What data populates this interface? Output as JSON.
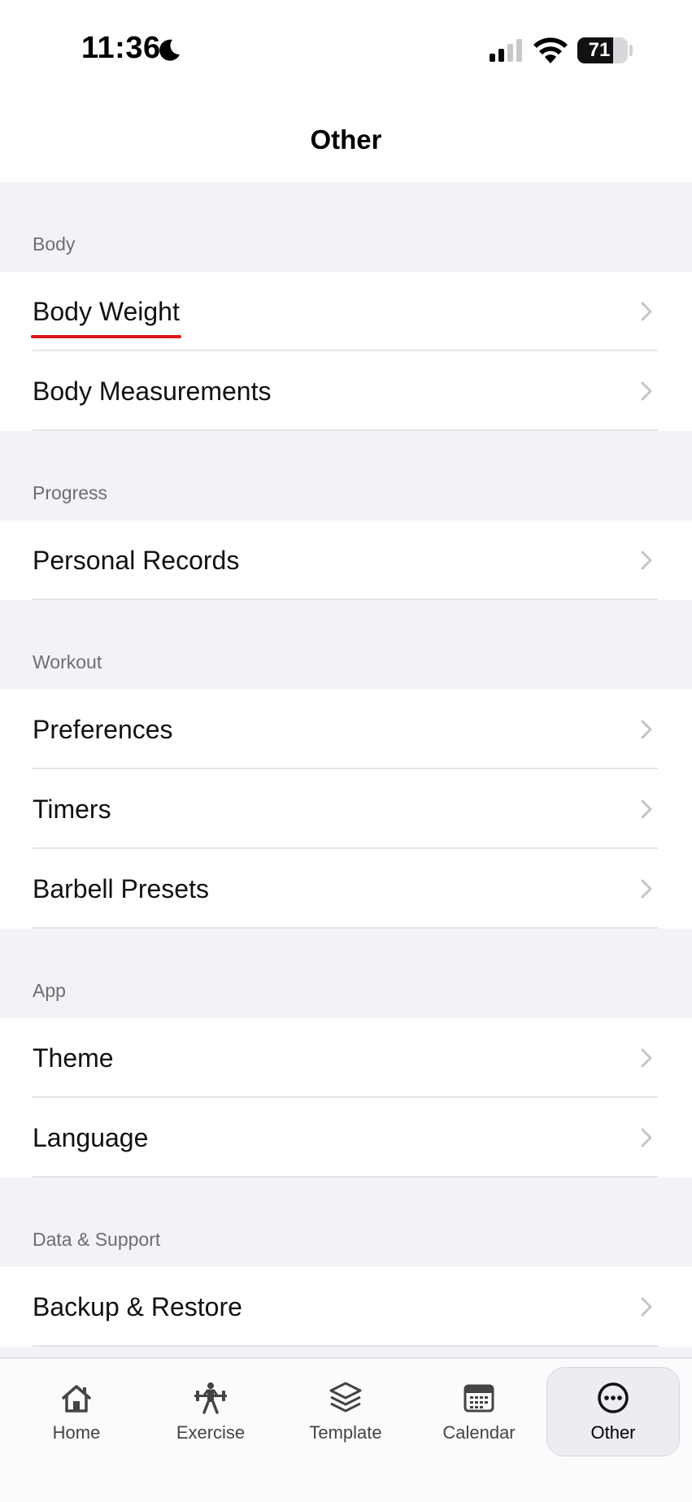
{
  "status_bar": {
    "time": "11:36",
    "battery": "71",
    "battery_level": 71,
    "icons": [
      "moon-icon",
      "cellular-signal-icon",
      "wifi-icon",
      "battery-icon"
    ]
  },
  "header": {
    "title": "Other"
  },
  "sections": [
    {
      "title": "Body",
      "items": [
        {
          "label": "Body Weight"
        },
        {
          "label": "Body Measurements"
        }
      ]
    },
    {
      "title": "Progress",
      "items": [
        {
          "label": "Personal Records"
        }
      ]
    },
    {
      "title": "Workout",
      "items": [
        {
          "label": "Preferences"
        },
        {
          "label": "Timers"
        },
        {
          "label": "Barbell Presets"
        }
      ]
    },
    {
      "title": "App",
      "items": [
        {
          "label": "Theme"
        },
        {
          "label": "Language"
        }
      ]
    },
    {
      "title": "Data & Support",
      "items": [
        {
          "label": "Backup & Restore"
        }
      ]
    }
  ],
  "annotation": {
    "underline_color": "#e0141c",
    "target": "Body Weight"
  },
  "tab_bar": {
    "tabs": [
      {
        "label": "Home",
        "icon": "home-icon"
      },
      {
        "label": "Exercise",
        "icon": "exercise-icon"
      },
      {
        "label": "Template",
        "icon": "template-layers-icon"
      },
      {
        "label": "Calendar",
        "icon": "calendar-icon"
      },
      {
        "label": "Other",
        "icon": "more-dots-icon",
        "active": true
      }
    ]
  },
  "colors": {
    "background": "#f2f2f7",
    "surface": "#ffffff",
    "section_header_text": "#6d6d72",
    "separator": "#e4e4e8",
    "chevron": "#c4c4c8",
    "active_tab_bg": "#ececf1"
  }
}
